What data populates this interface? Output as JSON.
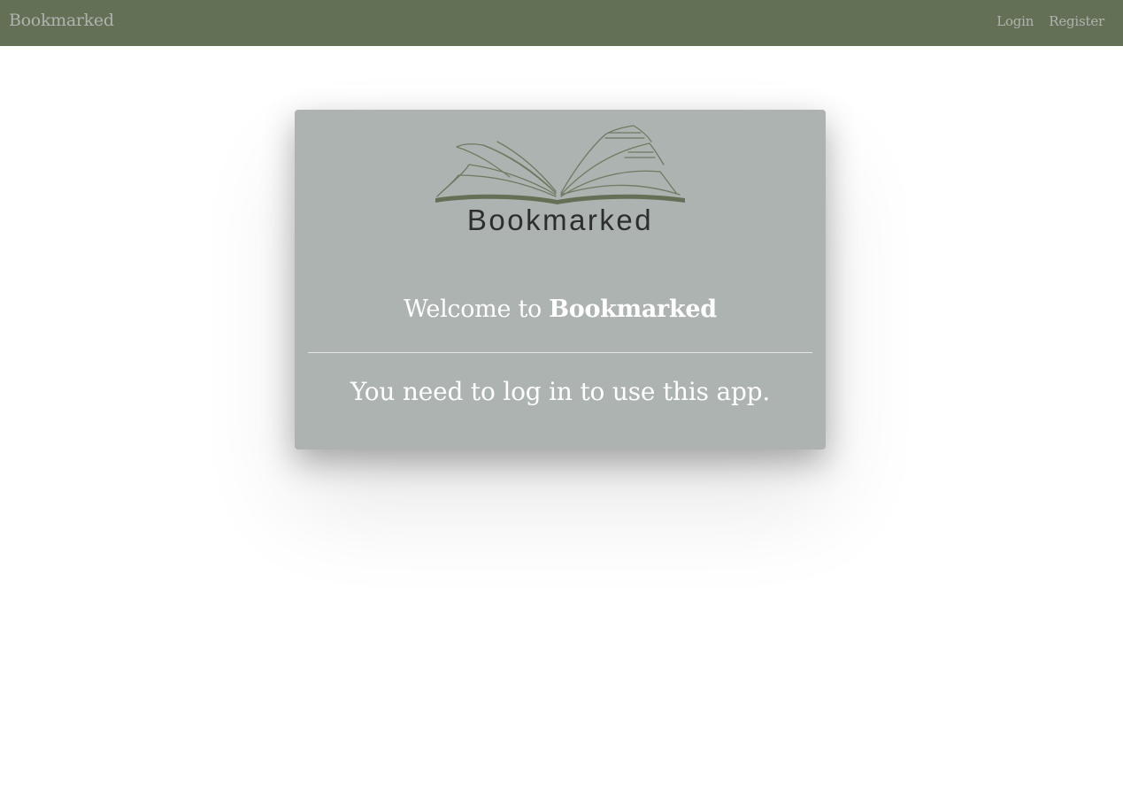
{
  "navbar": {
    "brand": "Bookmarked",
    "links": [
      {
        "label": "Login"
      },
      {
        "label": "Register"
      }
    ]
  },
  "card": {
    "logo_text": "Bookmarked",
    "welcome_prefix": "Welcome to ",
    "welcome_brand": "Bookmarked",
    "message": "You need to log in to use this app."
  },
  "colors": {
    "navbar_bg": "#647056",
    "nav_text": "#aeb3b0",
    "card_bg": "#adb3b0",
    "card_text": "#ffffff",
    "logo_book": "#647056",
    "logo_text": "#2c2f2d"
  }
}
